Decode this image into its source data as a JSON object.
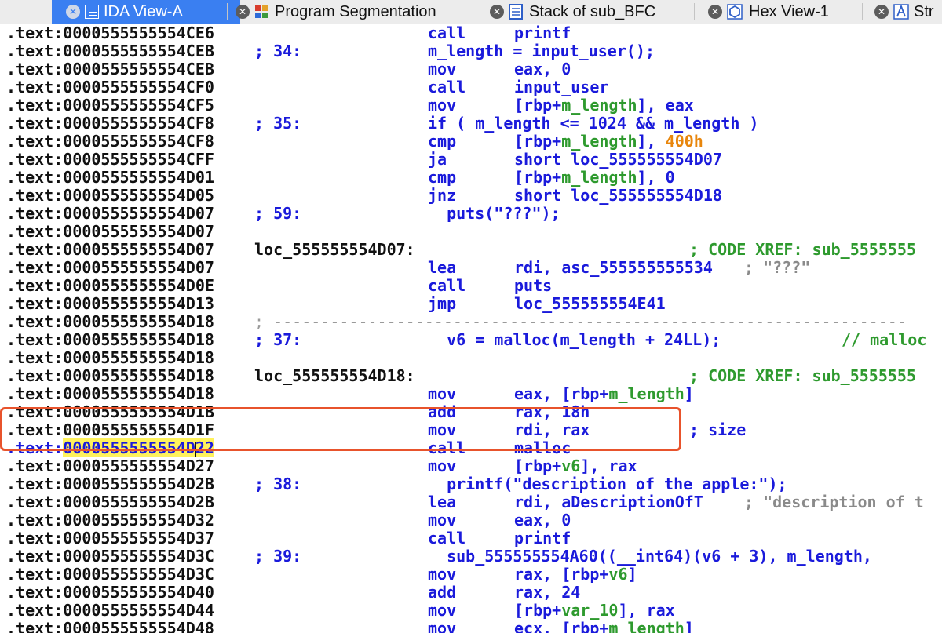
{
  "tabs": [
    {
      "label": "IDA View-A",
      "icon": "ida-view-icon",
      "active": true
    },
    {
      "label": "Program Segmentation",
      "icon": "segmentation-icon",
      "active": false
    },
    {
      "label": "Stack of sub_BFC",
      "icon": "stack-icon",
      "active": false
    },
    {
      "label": "Hex View-1",
      "icon": "hex-icon",
      "active": false
    },
    {
      "label": "Str",
      "icon": "strings-icon",
      "active": false
    }
  ],
  "listing": {
    "segment": ".text:",
    "rows": [
      {
        "addr": "0000555555554CE6",
        "note": "",
        "mn": "call",
        "ops": "printf"
      },
      {
        "addr": "0000555555554CEB",
        "note": "; 34:",
        "src": "m_length = input_user();"
      },
      {
        "addr": "0000555555554CEB",
        "note": "",
        "mn": "mov",
        "ops": "eax, 0"
      },
      {
        "addr": "0000555555554CF0",
        "note": "",
        "mn": "call",
        "ops": "input_user"
      },
      {
        "addr": "0000555555554CF5",
        "note": "",
        "mn": "mov",
        "ops_a": "[rbp+",
        "ops_b": "m_length",
        "ops_c": "], eax"
      },
      {
        "addr": "0000555555554CF8",
        "note": "; 35:",
        "src": "if ( m_length <= 1024 && m_length )"
      },
      {
        "addr": "0000555555554CF8",
        "note": "",
        "mn": "cmp",
        "ops_a": "[rbp+",
        "ops_b": "m_length",
        "ops_c": "], ",
        "ops_d": "400h"
      },
      {
        "addr": "0000555555554CFF",
        "note": "",
        "mn": "ja",
        "ops": "short loc_555555554D07"
      },
      {
        "addr": "0000555555554D01",
        "note": "",
        "mn": "cmp",
        "ops_a": "[rbp+",
        "ops_b": "m_length",
        "ops_c": "], 0"
      },
      {
        "addr": "0000555555554D05",
        "note": "",
        "mn": "jnz",
        "ops": "short loc_555555554D18"
      },
      {
        "addr": "0000555555554D07",
        "note": "; 59:",
        "src": "  puts(\"???\");"
      },
      {
        "addr": "0000555555554D07",
        "note": ""
      },
      {
        "addr": "0000555555554D07",
        "label": "loc_555555554D07:",
        "comment": "; CODE XREF: sub_5555555"
      },
      {
        "addr": "0000555555554D07",
        "note": "",
        "mn": "lea",
        "ops": "rdi, asc_555555555534",
        "comment_grey": "; \"???\""
      },
      {
        "addr": "0000555555554D0E",
        "note": "",
        "mn": "call",
        "ops": "puts"
      },
      {
        "addr": "0000555555554D13",
        "note": "",
        "mn": "jmp",
        "ops": "loc_555555554E41"
      },
      {
        "addr": "0000555555554D18",
        "separator": "; -------------------------------------------------------------------"
      },
      {
        "addr": "0000555555554D18",
        "note": "; 37:",
        "src": "  v6 = malloc(m_length + 24LL);",
        "comment": "// malloc"
      },
      {
        "addr": "0000555555554D18",
        "note": ""
      },
      {
        "addr": "0000555555554D18",
        "label": "loc_555555554D18:",
        "comment": "; CODE XREF: sub_5555555"
      },
      {
        "addr": "0000555555554D18",
        "note": "",
        "mn": "mov",
        "ops_a": "eax, [rbp+",
        "ops_b": "m_length",
        "ops_c": "]"
      },
      {
        "addr": "0000555555554D1B",
        "note": "",
        "mn": "add",
        "ops": "rax, 18h"
      },
      {
        "addr": "0000555555554D1F",
        "note": "",
        "mn": "mov",
        "ops": "rdi, rax",
        "comment_blue": "; size"
      },
      {
        "addr": "0000555555554D22",
        "note": "",
        "mn": "call",
        "ops": "malloc",
        "selected": true
      },
      {
        "addr": "0000555555554D27",
        "note": "",
        "mn": "mov",
        "ops_a": "[rbp+",
        "ops_b": "v6",
        "ops_c": "], rax"
      },
      {
        "addr": "0000555555554D2B",
        "note": "; 38:",
        "src": "  printf(\"description of the apple:\");"
      },
      {
        "addr": "0000555555554D2B",
        "note": "",
        "mn": "lea",
        "ops": "rdi, aDescriptionOfT",
        "comment_grey": "; \"description of t"
      },
      {
        "addr": "0000555555554D32",
        "note": "",
        "mn": "mov",
        "ops": "eax, 0"
      },
      {
        "addr": "0000555555554D37",
        "note": "",
        "mn": "call",
        "ops": "printf"
      },
      {
        "addr": "0000555555554D3C",
        "note": "; 39:",
        "src": "  sub_555555554A60((__int64)(v6 + 3), m_length,"
      },
      {
        "addr": "0000555555554D3C",
        "note": "",
        "mn": "mov",
        "ops_a": "rax, [rbp+",
        "ops_b": "v6",
        "ops_c": "]"
      },
      {
        "addr": "0000555555554D40",
        "note": "",
        "mn": "add",
        "ops": "rax, 24"
      },
      {
        "addr": "0000555555554D44",
        "note": "",
        "mn": "mov",
        "ops_a": "[rbp+",
        "ops_b": "var_10",
        "ops_c": "], rax"
      },
      {
        "addr": "0000555555554D48",
        "note": "",
        "mn": "mov",
        "ops_a": "ecx, [rbp+",
        "ops_b": "m_length",
        "ops_c": "]"
      }
    ]
  },
  "colors": {
    "active_tab": "#3a7ff1",
    "mnemonic": "#1a1adb",
    "variable": "#2e9a2e",
    "immediate": "#e8860c",
    "address_highlight": "#fff25c",
    "annotation_box": "#e8532c"
  }
}
